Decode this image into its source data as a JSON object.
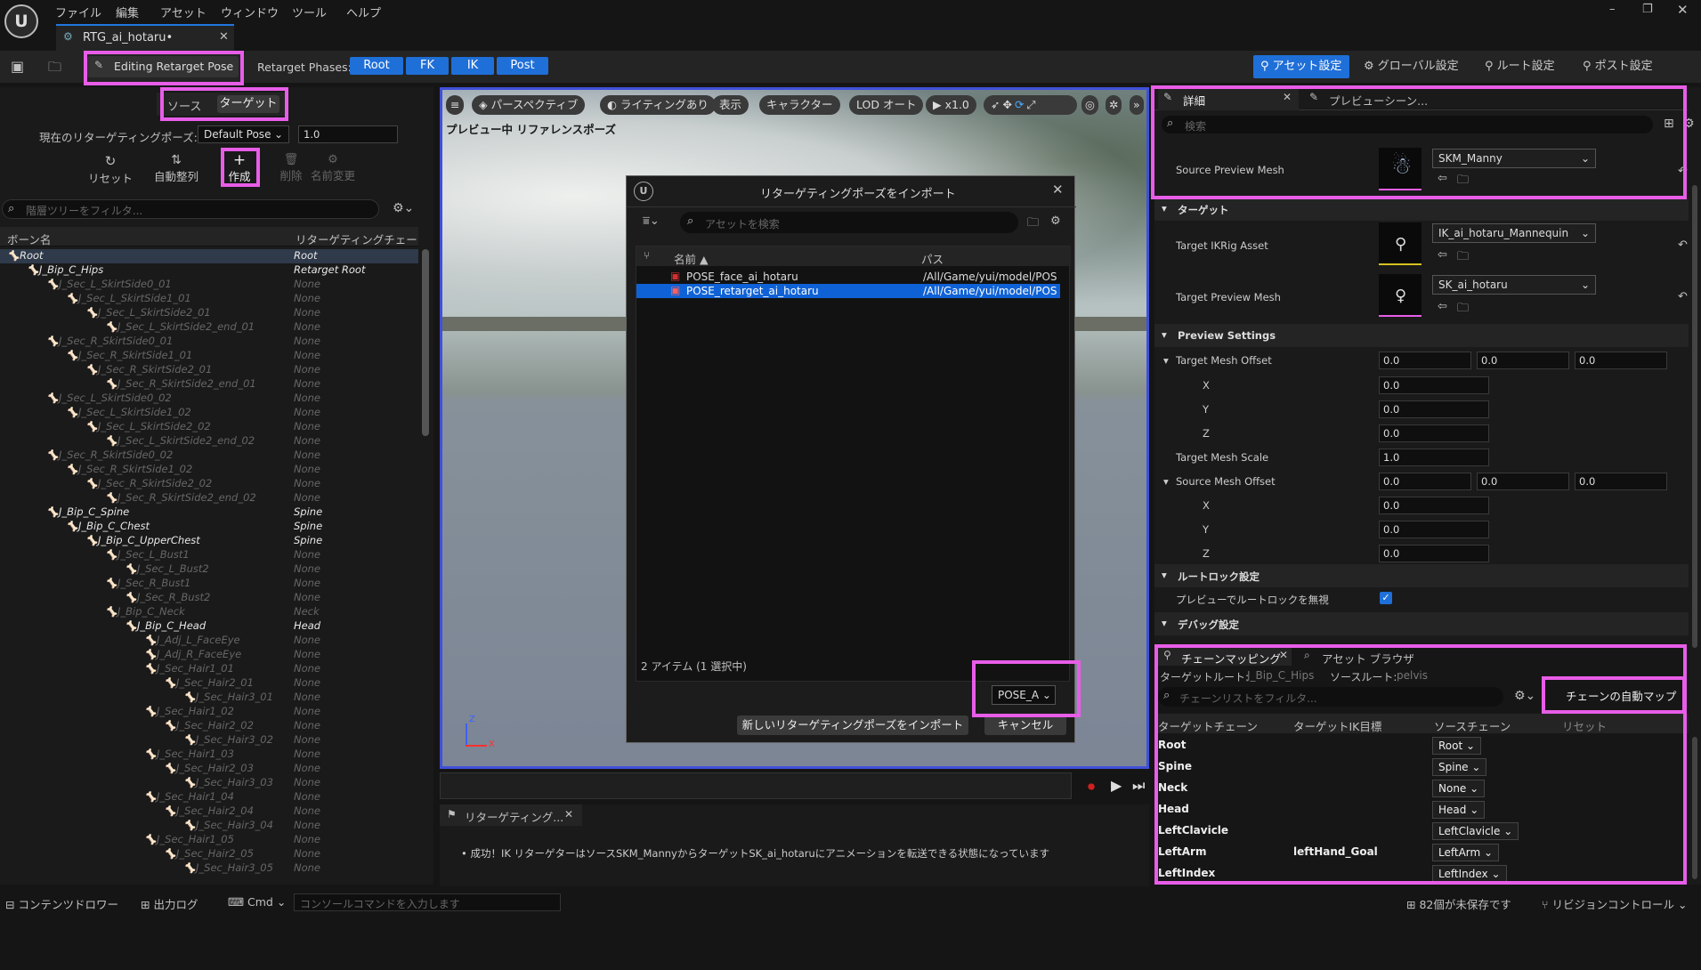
{
  "app": {
    "logo": "U",
    "menu": [
      "ファイル",
      "編集",
      "アセット",
      "ウィンドウ",
      "ツール",
      "ヘルプ"
    ],
    "tab_title": "RTG_ai_hotaru•"
  },
  "toolbar": {
    "editing_pose": "Editing Retarget Pose",
    "phases_label": "Retarget Phases:",
    "phases": [
      "Root",
      "FK",
      "IK",
      "Post"
    ],
    "right": [
      "アセット設定",
      "グローバル設定",
      "ルート設定",
      "ポスト設定"
    ]
  },
  "left": {
    "tabs": [
      "ソース",
      "ターゲット"
    ],
    "current_pose_label": "現在のリターゲティングポーズ:",
    "current_pose": "Default Pose",
    "blend_value": "1.0",
    "actions": [
      "リセット",
      "自動整列",
      "作成",
      "削除",
      "名前変更"
    ],
    "filter_placeholder": "階層ツリーをフィルタ...",
    "col_bone": "ボーン名",
    "col_chain": "リターゲティングチェー"
  },
  "bones": [
    {
      "name": "Root",
      "chain": "Root",
      "depth": 0,
      "active": true
    },
    {
      "name": "J_Bip_C_Hips",
      "chain": "Retarget Root",
      "depth": 1,
      "active": true
    },
    {
      "name": "J_Sec_L_SkirtSide0_01",
      "chain": "None",
      "depth": 2
    },
    {
      "name": "J_Sec_L_SkirtSide1_01",
      "chain": "None",
      "depth": 3
    },
    {
      "name": "J_Sec_L_SkirtSide2_01",
      "chain": "None",
      "depth": 4
    },
    {
      "name": "J_Sec_L_SkirtSide2_end_01",
      "chain": "None",
      "depth": 5
    },
    {
      "name": "J_Sec_R_SkirtSide0_01",
      "chain": "None",
      "depth": 2
    },
    {
      "name": "J_Sec_R_SkirtSide1_01",
      "chain": "None",
      "depth": 3
    },
    {
      "name": "J_Sec_R_SkirtSide2_01",
      "chain": "None",
      "depth": 4
    },
    {
      "name": "J_Sec_R_SkirtSide2_end_01",
      "chain": "None",
      "depth": 5
    },
    {
      "name": "J_Sec_L_SkirtSide0_02",
      "chain": "None",
      "depth": 2
    },
    {
      "name": "J_Sec_L_SkirtSide1_02",
      "chain": "None",
      "depth": 3
    },
    {
      "name": "J_Sec_L_SkirtSide2_02",
      "chain": "None",
      "depth": 4
    },
    {
      "name": "J_Sec_L_SkirtSide2_end_02",
      "chain": "None",
      "depth": 5
    },
    {
      "name": "J_Sec_R_SkirtSide0_02",
      "chain": "None",
      "depth": 2
    },
    {
      "name": "J_Sec_R_SkirtSide1_02",
      "chain": "None",
      "depth": 3
    },
    {
      "name": "J_Sec_R_SkirtSide2_02",
      "chain": "None",
      "depth": 4
    },
    {
      "name": "J_Sec_R_SkirtSide2_end_02",
      "chain": "None",
      "depth": 5
    },
    {
      "name": "J_Bip_C_Spine",
      "chain": "Spine",
      "depth": 2,
      "active": true
    },
    {
      "name": "J_Bip_C_Chest",
      "chain": "Spine",
      "depth": 3,
      "active": true
    },
    {
      "name": "J_Bip_C_UpperChest",
      "chain": "Spine",
      "depth": 4,
      "active": true
    },
    {
      "name": "J_Sec_L_Bust1",
      "chain": "None",
      "depth": 5
    },
    {
      "name": "J_Sec_L_Bust2",
      "chain": "None",
      "depth": 6
    },
    {
      "name": "J_Sec_R_Bust1",
      "chain": "None",
      "depth": 5
    },
    {
      "name": "J_Sec_R_Bust2",
      "chain": "None",
      "depth": 6
    },
    {
      "name": "J_Bip_C_Neck",
      "chain": "Neck",
      "depth": 5
    },
    {
      "name": "J_Bip_C_Head",
      "chain": "Head",
      "depth": 6,
      "active": true
    },
    {
      "name": "J_Adj_L_FaceEye",
      "chain": "None",
      "depth": 7
    },
    {
      "name": "J_Adj_R_FaceEye",
      "chain": "None",
      "depth": 7
    },
    {
      "name": "J_Sec_Hair1_01",
      "chain": "None",
      "depth": 7
    },
    {
      "name": "J_Sec_Hair2_01",
      "chain": "None",
      "depth": 8
    },
    {
      "name": "J_Sec_Hair3_01",
      "chain": "None",
      "depth": 9
    },
    {
      "name": "J_Sec_Hair1_02",
      "chain": "None",
      "depth": 7
    },
    {
      "name": "J_Sec_Hair2_02",
      "chain": "None",
      "depth": 8
    },
    {
      "name": "J_Sec_Hair3_02",
      "chain": "None",
      "depth": 9
    },
    {
      "name": "J_Sec_Hair1_03",
      "chain": "None",
      "depth": 7
    },
    {
      "name": "J_Sec_Hair2_03",
      "chain": "None",
      "depth": 8
    },
    {
      "name": "J_Sec_Hair3_03",
      "chain": "None",
      "depth": 9
    },
    {
      "name": "J_Sec_Hair1_04",
      "chain": "None",
      "depth": 7
    },
    {
      "name": "J_Sec_Hair2_04",
      "chain": "None",
      "depth": 8
    },
    {
      "name": "J_Sec_Hair3_04",
      "chain": "None",
      "depth": 9
    },
    {
      "name": "J_Sec_Hair1_05",
      "chain": "None",
      "depth": 7
    },
    {
      "name": "J_Sec_Hair2_05",
      "chain": "None",
      "depth": 8
    },
    {
      "name": "J_Sec_Hair3_05",
      "chain": "None",
      "depth": 9
    }
  ],
  "viewport": {
    "menu_icon": "hamburger-icon",
    "perspective": "パースペクティブ",
    "lighting": "ライティングあり",
    "show": "表示",
    "character": "キャラクター",
    "lod": "LOD オート",
    "speed": "x1.0",
    "preview_label": "プレビュー中 リファレンスポーズ",
    "axis_z": "Z",
    "axis_x": "X"
  },
  "dialog": {
    "title": "リターゲティングポーズをインポート",
    "search_placeholder": "アセットを検索",
    "col_name": "名前",
    "col_path": "パス",
    "items": [
      {
        "name": "POSE_face_ai_hotaru",
        "path": "/All/Game/yui/model/POS"
      },
      {
        "name": "POSE_retarget_ai_hotaru",
        "path": "/All/Game/yui/model/POS",
        "selected": true
      }
    ],
    "count": "2 アイテム (1 選択中)",
    "pose_dropdown": "POSE_A",
    "import_button": "新しいリターゲティングポーズをインポート",
    "cancel_button": "キャンセル"
  },
  "log": {
    "tab": "リターゲティング...",
    "message": "成功！IK リターゲターはソースSKM_MannyからターゲットSK_ai_hotaruにアニメーションを転送できる状態になっています"
  },
  "details": {
    "tab_details": "詳細",
    "tab_preview": "プレビューシーン...",
    "search_placeholder": "検索",
    "source_preview_mesh_label": "Source Preview Mesh",
    "source_preview_mesh": "SKM_Manny",
    "section_target": "ターゲット",
    "target_ikrig_label": "Target IKRig Asset",
    "target_ikrig": "IK_ai_hotaru_Mannequin",
    "target_preview_mesh_label": "Target Preview Mesh",
    "target_preview_mesh": "SK_ai_hotaru",
    "section_preview": "Preview Settings",
    "target_mesh_offset_label": "Target Mesh Offset",
    "target_mesh_offset": [
      "0.0",
      "0.0",
      "0.0"
    ],
    "axis_x": "X",
    "axis_y": "Y",
    "axis_z": "Z",
    "target_mesh_scale_label": "Target Mesh Scale",
    "target_mesh_scale": "1.0",
    "source_mesh_offset_label": "Source Mesh Offset",
    "source_mesh_offset": [
      "0.0",
      "0.0",
      "0.0"
    ],
    "section_rootlock": "ルートロック設定",
    "rootlock_label": "プレビューでルートロックを無視",
    "section_debug": "デバッグ設定"
  },
  "chain": {
    "tab_mapping": "チェーンマッピング",
    "tab_browser": "アセット ブラウザ",
    "target_root_label": "ターゲットルート:",
    "target_root": "J_Bip_C_Hips",
    "source_root_label": "ソースルート:",
    "source_root": "pelvis",
    "filter_placeholder": "チェーンリストをフィルタ...",
    "auto_map": "チェーンの自動マップ",
    "col_target": "ターゲットチェーン",
    "col_ik": "ターゲットIK目標",
    "col_source": "ソースチェーン",
    "col_reset": "リセット",
    "rows": [
      {
        "target": "Root",
        "ik": "",
        "source": "Root"
      },
      {
        "target": "Spine",
        "ik": "",
        "source": "Spine"
      },
      {
        "target": "Neck",
        "ik": "",
        "source": "None"
      },
      {
        "target": "Head",
        "ik": "",
        "source": "Head"
      },
      {
        "target": "LeftClavicle",
        "ik": "",
        "source": "LeftClavicle"
      },
      {
        "target": "LeftArm",
        "ik": "leftHand_Goal",
        "source": "LeftArm"
      },
      {
        "target": "LeftIndex",
        "ik": "",
        "source": "LeftIndex"
      }
    ]
  },
  "statusbar": {
    "content_drawer": "コンテンツドロワー",
    "output_log": "出力ログ",
    "cmd": "Cmd",
    "console_placeholder": "コンソールコマンドを入力します",
    "unsaved": "82個が未保存です",
    "revision": "リビジョンコントロール"
  },
  "colors": {
    "accent": "#1f6fd8",
    "highlight": "#e85de8",
    "selected": "#0f62d6"
  }
}
